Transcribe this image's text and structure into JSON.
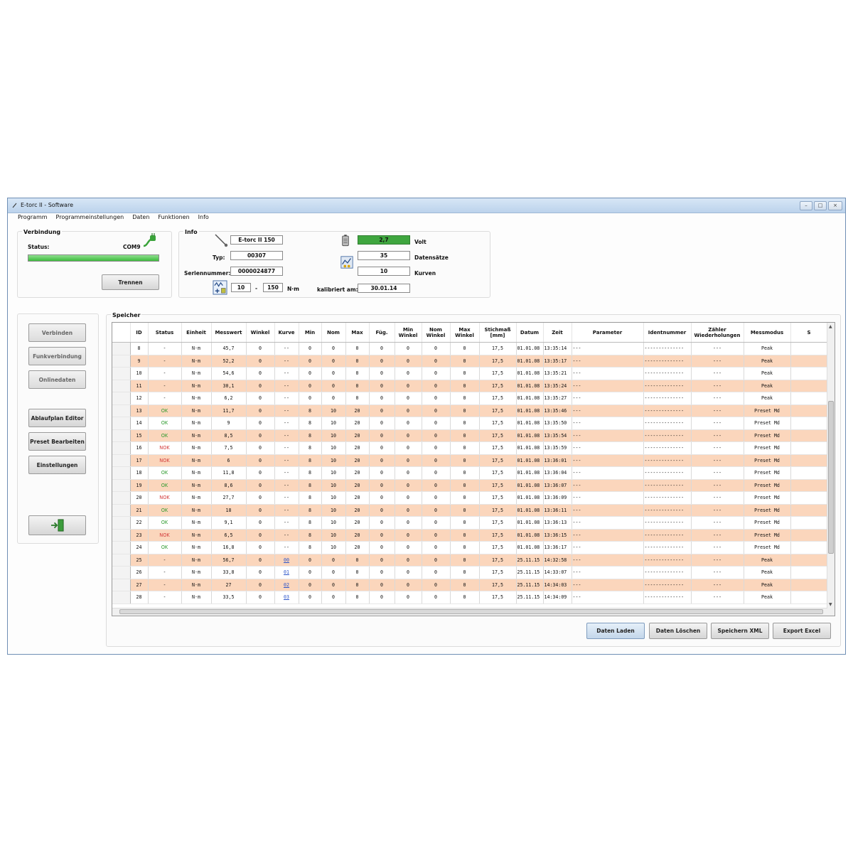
{
  "window": {
    "title": "E-torc II - Software"
  },
  "menu": [
    "Programm",
    "Programmeinstellungen",
    "Daten",
    "Funktionen",
    "Info"
  ],
  "verbindung": {
    "title": "Verbindung",
    "status_label": "Status:",
    "port": "COM9",
    "progress_fraction": 1.0,
    "disconnect_button": "Trennen"
  },
  "info": {
    "title": "Info",
    "device": "E-torc II 150",
    "typ_label": "Typ:",
    "typ": "00307",
    "serial_label": "Seriennummer:",
    "serial": "0000024877",
    "range_min": "10",
    "range_sep": "-",
    "range_max": "150",
    "range_unit": "N·m",
    "voltage": "2,7",
    "voltage_label": "Volt",
    "records": "35",
    "records_label": "Datensätze",
    "curves": "10",
    "curves_label": "Kurven",
    "calibrated_label": "kalibriert am:",
    "calibrated": "30.01.14"
  },
  "sidebar": {
    "connect": "Verbinden",
    "radio": "Funkverbindung",
    "online": "Onlinedaten",
    "flow_editor": "Ablaufplan Editor",
    "preset": "Preset Bearbeiten",
    "settings": "Einstellungen"
  },
  "memory": {
    "title": "Speicher",
    "columns": [
      "ID",
      "Status",
      "Einheit",
      "Messwert",
      "Winkel",
      "Kurve",
      "Min",
      "Nom",
      "Max",
      "Füg.",
      "Min Winkel",
      "Nom Winkel",
      "Max Winkel",
      "Stichmaß [mm]",
      "Datum",
      "Zeit",
      "Parameter",
      "Identnummer",
      "Zähler Wiederholungen",
      "Messmodus",
      "S"
    ],
    "rows": [
      [
        "8",
        "-",
        "N·m",
        "45,7",
        "0",
        "--",
        "0",
        "0",
        "0",
        "0",
        "0",
        "0",
        "0",
        "17,5",
        "01.01.08",
        "13:35:14",
        "---",
        "--------------",
        "---",
        "Peak"
      ],
      [
        "9",
        "-",
        "N·m",
        "52,2",
        "0",
        "--",
        "0",
        "0",
        "0",
        "0",
        "0",
        "0",
        "0",
        "17,5",
        "01.01.08",
        "13:35:17",
        "---",
        "--------------",
        "---",
        "Peak"
      ],
      [
        "10",
        "-",
        "N·m",
        "54,6",
        "0",
        "--",
        "0",
        "0",
        "0",
        "0",
        "0",
        "0",
        "0",
        "17,5",
        "01.01.08",
        "13:35:21",
        "---",
        "--------------",
        "---",
        "Peak"
      ],
      [
        "11",
        "-",
        "N·m",
        "30,1",
        "0",
        "--",
        "0",
        "0",
        "0",
        "0",
        "0",
        "0",
        "0",
        "17,5",
        "01.01.08",
        "13:35:24",
        "---",
        "--------------",
        "---",
        "Peak"
      ],
      [
        "12",
        "-",
        "N·m",
        "6,2",
        "0",
        "--",
        "0",
        "0",
        "0",
        "0",
        "0",
        "0",
        "0",
        "17,5",
        "01.01.08",
        "13:35:27",
        "---",
        "--------------",
        "---",
        "Peak"
      ],
      [
        "13",
        "OK",
        "N·m",
        "11,7",
        "0",
        "--",
        "8",
        "10",
        "20",
        "0",
        "0",
        "0",
        "0",
        "17,5",
        "01.01.08",
        "13:35:46",
        "---",
        "--------------",
        "---",
        "Preset Md"
      ],
      [
        "14",
        "OK",
        "N·m",
        "9",
        "0",
        "--",
        "8",
        "10",
        "20",
        "0",
        "0",
        "0",
        "0",
        "17,5",
        "01.01.08",
        "13:35:50",
        "---",
        "--------------",
        "---",
        "Preset Md"
      ],
      [
        "15",
        "OK",
        "N·m",
        "8,5",
        "0",
        "--",
        "8",
        "10",
        "20",
        "0",
        "0",
        "0",
        "0",
        "17,5",
        "01.01.08",
        "13:35:54",
        "---",
        "--------------",
        "---",
        "Preset Md"
      ],
      [
        "16",
        "NOK",
        "N·m",
        "7,5",
        "0",
        "--",
        "8",
        "10",
        "20",
        "0",
        "0",
        "0",
        "0",
        "17,5",
        "01.01.08",
        "13:35:59",
        "---",
        "--------------",
        "---",
        "Preset Md"
      ],
      [
        "17",
        "NOK",
        "N·m",
        "6",
        "0",
        "--",
        "8",
        "10",
        "20",
        "0",
        "0",
        "0",
        "0",
        "17,5",
        "01.01.08",
        "13:36:01",
        "---",
        "--------------",
        "---",
        "Preset Md"
      ],
      [
        "18",
        "OK",
        "N·m",
        "11,8",
        "0",
        "--",
        "8",
        "10",
        "20",
        "0",
        "0",
        "0",
        "0",
        "17,5",
        "01.01.08",
        "13:36:04",
        "---",
        "--------------",
        "---",
        "Preset Md"
      ],
      [
        "19",
        "OK",
        "N·m",
        "8,6",
        "0",
        "--",
        "8",
        "10",
        "20",
        "0",
        "0",
        "0",
        "0",
        "17,5",
        "01.01.08",
        "13:36:07",
        "---",
        "--------------",
        "---",
        "Preset Md"
      ],
      [
        "20",
        "NOK",
        "N·m",
        "27,7",
        "0",
        "--",
        "8",
        "10",
        "20",
        "0",
        "0",
        "0",
        "0",
        "17,5",
        "01.01.08",
        "13:36:09",
        "---",
        "--------------",
        "---",
        "Preset Md"
      ],
      [
        "21",
        "OK",
        "N·m",
        "18",
        "0",
        "--",
        "8",
        "10",
        "20",
        "0",
        "0",
        "0",
        "0",
        "17,5",
        "01.01.08",
        "13:36:11",
        "---",
        "--------------",
        "---",
        "Preset Md"
      ],
      [
        "22",
        "OK",
        "N·m",
        "9,1",
        "0",
        "--",
        "8",
        "10",
        "20",
        "0",
        "0",
        "0",
        "0",
        "17,5",
        "01.01.08",
        "13:36:13",
        "---",
        "--------------",
        "---",
        "Preset Md"
      ],
      [
        "23",
        "NOK",
        "N·m",
        "6,5",
        "0",
        "--",
        "8",
        "10",
        "20",
        "0",
        "0",
        "0",
        "0",
        "17,5",
        "01.01.08",
        "13:36:15",
        "---",
        "--------------",
        "---",
        "Preset Md"
      ],
      [
        "24",
        "OK",
        "N·m",
        "16,8",
        "0",
        "--",
        "8",
        "10",
        "20",
        "0",
        "0",
        "0",
        "0",
        "17,5",
        "01.01.08",
        "13:36:17",
        "---",
        "--------------",
        "---",
        "Preset Md"
      ],
      [
        "25",
        "-",
        "N·m",
        "56,7",
        "0",
        "00",
        "0",
        "0",
        "0",
        "0",
        "0",
        "0",
        "0",
        "17,5",
        "25.11.15",
        "14:32:58",
        "---",
        "--------------",
        "---",
        "Peak"
      ],
      [
        "26",
        "-",
        "N·m",
        "33,8",
        "0",
        "01",
        "0",
        "0",
        "0",
        "0",
        "0",
        "0",
        "0",
        "17,5",
        "25.11.15",
        "14:33:07",
        "---",
        "--------------",
        "---",
        "Peak"
      ],
      [
        "27",
        "-",
        "N·m",
        "27",
        "0",
        "02",
        "0",
        "0",
        "0",
        "0",
        "0",
        "0",
        "0",
        "17,5",
        "25.11.15",
        "14:34:03",
        "---",
        "--------------",
        "---",
        "Peak"
      ],
      [
        "28",
        "-",
        "N·m",
        "33,5",
        "0",
        "03",
        "0",
        "0",
        "0",
        "0",
        "0",
        "0",
        "0",
        "17,5",
        "25.11.15",
        "14:34:09",
        "---",
        "--------------",
        "---",
        "Peak"
      ]
    ]
  },
  "footer_buttons": {
    "load": "Daten Laden",
    "delete": "Daten Löschen",
    "save_xml": "Speichern XML",
    "export_excel": "Export Excel"
  },
  "colors": {
    "row_highlight": "#fbd6bc",
    "ok": "#2d9a2d",
    "nok": "#d23a3a",
    "link": "#2a53c9"
  }
}
